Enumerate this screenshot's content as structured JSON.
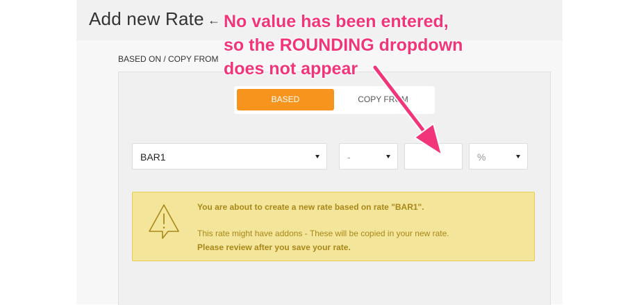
{
  "header": {
    "title": "Add new Rate",
    "back_icon": "←"
  },
  "form": {
    "section_label": "BASED ON / COPY FROM",
    "toggle": {
      "based_label": "BASED",
      "copy_label": "COPY FROM",
      "active": "BASED",
      "active_color": "#f7941d"
    },
    "rate_select": {
      "value": "BAR1"
    },
    "sign_select": {
      "value": "-"
    },
    "value_input": {
      "value": ""
    },
    "unit_select": {
      "value": "%"
    }
  },
  "warning": {
    "line1": "You are about to create a new rate based on rate \"BAR1\".",
    "line2": "This rate might have addons - These will be copied in your new rate.",
    "line3": "Please review after you save your rate.",
    "icon": "warning-triangle-icon",
    "background": "#f3e59a",
    "text_color": "#a9881a"
  },
  "annotation": {
    "lines": [
      "No value has been entered,",
      "so the ROUNDING dropdown",
      "does not appear"
    ],
    "color": "#f2357a"
  }
}
